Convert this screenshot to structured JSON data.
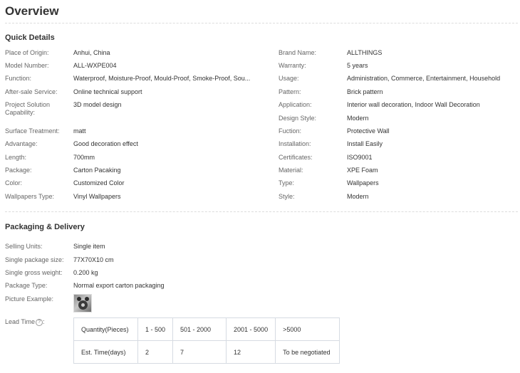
{
  "overview_title": "Overview",
  "quick_details": {
    "title": "Quick Details",
    "left": [
      {
        "key": "Place of Origin:",
        "value": "Anhui, China"
      },
      {
        "key": "Model Number:",
        "value": "ALL-WXPE004"
      },
      {
        "key": "Function:",
        "value": "Waterproof, Moisture-Proof, Mould-Proof, Smoke-Proof, Sou..."
      },
      {
        "key": "After-sale Service:",
        "value": "Online technical support"
      },
      {
        "key": "Project Solution Capability:",
        "value": "3D model design"
      },
      {
        "key": "Surface Treatment:",
        "value": "matt"
      },
      {
        "key": "Advantage:",
        "value": "Good decoration effect"
      },
      {
        "key": "Length:",
        "value": "700mm"
      },
      {
        "key": "Package:",
        "value": "Carton Pacaking"
      },
      {
        "key": "Color:",
        "value": "Customized Color"
      },
      {
        "key": "Wallpapers Type:",
        "value": "Vinyl Wallpapers"
      }
    ],
    "right": [
      {
        "key": "Brand Name:",
        "value": "ALLTHINGS"
      },
      {
        "key": "Warranty:",
        "value": "5 years"
      },
      {
        "key": "Usage:",
        "value": "Administration, Commerce, Entertainment, Household"
      },
      {
        "key": "Pattern:",
        "value": "Brick pattern"
      },
      {
        "key": "Application:",
        "value": "Interior wall decoration, Indoor Wall Decoration"
      },
      {
        "key": "Design Style:",
        "value": "Modern"
      },
      {
        "key": "Fuction:",
        "value": "Protective Wall"
      },
      {
        "key": "Installation:",
        "value": "Install Easily"
      },
      {
        "key": "Certificates:",
        "value": "ISO9001"
      },
      {
        "key": "Material:",
        "value": "XPE Foam"
      },
      {
        "key": "Type:",
        "value": "Wallpapers"
      },
      {
        "key": "Style:",
        "value": "Modern"
      }
    ]
  },
  "packaging": {
    "title": "Packaging & Delivery",
    "rows": [
      {
        "key": "Selling Units:",
        "value": "Single item"
      },
      {
        "key": "Single package size:",
        "value": "77X70X10 cm"
      },
      {
        "key": "Single gross weight:",
        "value": "0.200 kg"
      },
      {
        "key": "Package Type:",
        "value": "Normal export carton packaging"
      }
    ],
    "picture_label": "Picture Example:",
    "lead_time_label": "Lead Time",
    "help_glyph": "?",
    "lead_table": {
      "header": [
        "Quantity(Pieces)",
        "1 - 500",
        "501 - 2000",
        "2001 - 5000",
        ">5000"
      ],
      "row": [
        "Est. Time(days)",
        "2",
        "7",
        "12",
        "To be negotiated"
      ]
    }
  }
}
